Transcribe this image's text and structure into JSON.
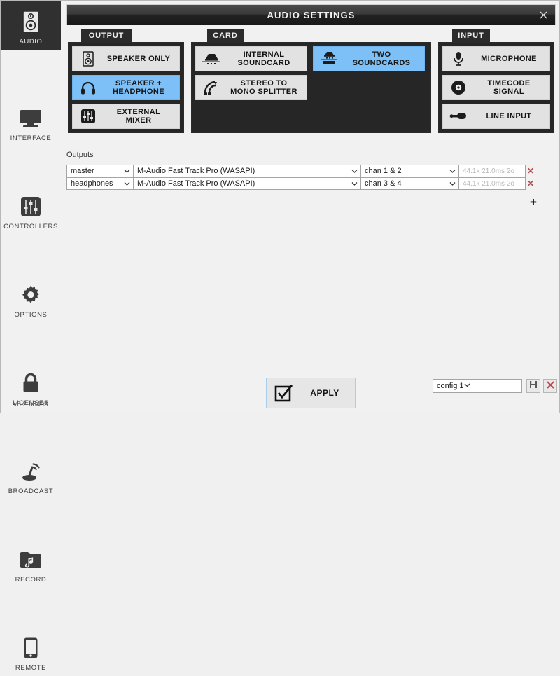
{
  "window": {
    "title": "AUDIO SETTINGS",
    "close_icon": "close-icon",
    "version": "v8.2 b3493"
  },
  "sidebar": {
    "items": [
      {
        "label": "AUDIO",
        "icon": "speaker-icon",
        "selected": true
      },
      {
        "label": "INTERFACE",
        "icon": "monitor-icon",
        "selected": false
      },
      {
        "label": "CONTROLLERS",
        "icon": "sliders-icon",
        "selected": false
      },
      {
        "label": "OPTIONS",
        "icon": "gear-icon",
        "selected": false
      },
      {
        "label": "LICENSES",
        "icon": "lock-icon",
        "selected": false
      },
      {
        "label": "BROADCAST",
        "icon": "broadcast-icon",
        "selected": false
      },
      {
        "label": "RECORD",
        "icon": "music-folder-icon",
        "selected": false
      },
      {
        "label": "REMOTE",
        "icon": "phone-icon",
        "selected": false
      }
    ]
  },
  "groups": {
    "output": {
      "tab_label": "OUTPUT",
      "buttons": [
        {
          "label": "SPEAKER ONLY",
          "icon": "speaker-icon",
          "active": false
        },
        {
          "label": "SPEAKER + HEADPHONE",
          "icon": "headphone-icon",
          "active": true
        },
        {
          "label": "EXTERNAL MIXER",
          "icon": "mixer-icon",
          "active": false
        }
      ]
    },
    "card": {
      "tab_label": "CARD",
      "buttons_left": [
        {
          "label": "INTERNAL SOUNDCARD",
          "icon": "soundcard-icon",
          "active": false
        },
        {
          "label": "STEREO TO MONO SPLITTER",
          "icon": "splitter-icon",
          "active": false
        }
      ],
      "buttons_right": [
        {
          "label": "TWO SOUNDCARDS",
          "icon": "two-soundcards-icon",
          "active": true
        }
      ]
    },
    "input": {
      "tab_label": "INPUT",
      "buttons": [
        {
          "label": "MICROPHONE",
          "icon": "microphone-icon",
          "active": false
        },
        {
          "label": "TIMECODE SIGNAL",
          "icon": "vinyl-icon",
          "active": false
        },
        {
          "label": "LINE INPUT",
          "icon": "plug-icon",
          "active": false
        }
      ]
    }
  },
  "outputs": {
    "label": "Outputs",
    "rows": [
      {
        "name": "master",
        "device": "M-Audio Fast Track Pro (WASAPI)",
        "channel": "chan 1 & 2",
        "latency": "44.1k 21.0ms 2o",
        "delete_icon": "delete-icon"
      },
      {
        "name": "headphones",
        "device": "M-Audio Fast Track Pro (WASAPI)",
        "channel": "chan 3 & 4",
        "latency": "44.1k 21.0ms 2o",
        "delete_icon": "delete-icon"
      }
    ],
    "add_label": "+"
  },
  "footer": {
    "apply_label": "APPLY",
    "apply_icon": "checkbox-check-icon",
    "config_value": "config 1",
    "save_icon": "floppy-save-icon",
    "delete_icon": "delete-config-icon"
  },
  "colors": {
    "accent_blue": "#7cc0f7",
    "panel_dark": "#262626",
    "button_grey": "#e2e2e2",
    "delete_red": "#b05050"
  }
}
